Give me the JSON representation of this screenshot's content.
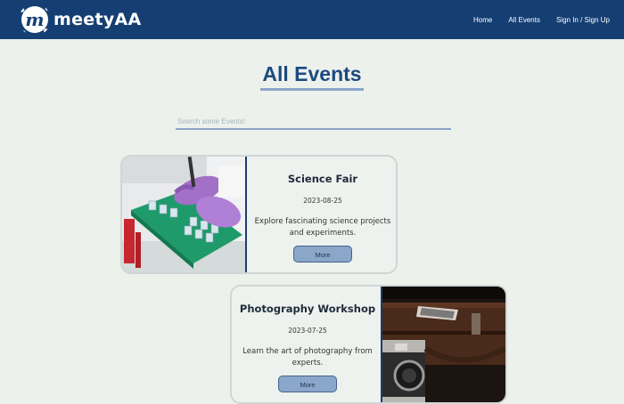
{
  "brand": {
    "name": "meetyAA",
    "badge_letter": "m"
  },
  "nav": {
    "home": "Home",
    "all_events": "All Events",
    "sign": "Sign In / Sign Up"
  },
  "page": {
    "title": "All Events"
  },
  "search": {
    "placeholder": "Search some Events!"
  },
  "events": [
    {
      "title": "Science Fair",
      "date": "2023-08-25",
      "description": "Explore fascinating science projects and experiments.",
      "button": "More"
    },
    {
      "title": "Photography Workshop",
      "date": "2023-07-25",
      "description": "Learn the art of photography from experts.",
      "button": "More"
    }
  ],
  "colors": {
    "navbar": "#153f73",
    "background": "#edf1ec",
    "accent": "#8aa6c8",
    "title": "#1c4a80"
  }
}
